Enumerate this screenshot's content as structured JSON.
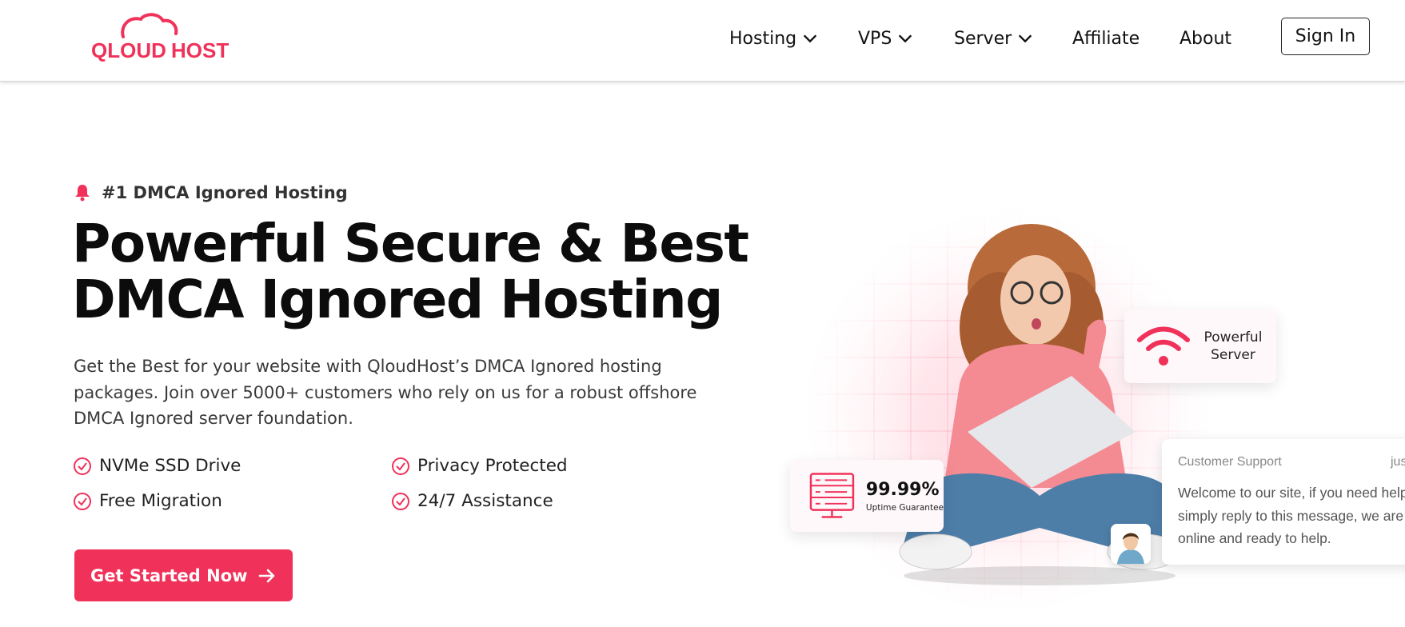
{
  "brand": {
    "name_part1": "QLOUD",
    "name_part2": "HOST",
    "color": "#f0325a"
  },
  "nav": {
    "items": [
      {
        "label": "Hosting",
        "has_dropdown": true
      },
      {
        "label": "VPS",
        "has_dropdown": true
      },
      {
        "label": "Server",
        "has_dropdown": true
      },
      {
        "label": "Affiliate",
        "has_dropdown": false
      },
      {
        "label": "About",
        "has_dropdown": false
      }
    ],
    "signin_label": "Sign In"
  },
  "hero": {
    "eyebrow": "#1 DMCA Ignored Hosting",
    "eyebrow_icon": "bell-icon",
    "headline_line1": "Powerful Secure & Best",
    "headline_line2": "DMCA Ignored Hosting",
    "description": "Get the Best for your website with QloudHost’s DMCA Ignored hosting packages. Join over 5000+ customers who rely on us for a robust offshore DMCA Ignored server foundation.",
    "features": [
      "NVMe SSD Drive",
      "Privacy Protected",
      "Free Migration",
      "24/7 Assistance"
    ],
    "feature_icon": "check-circle-icon",
    "cta_label": "Get Started Now",
    "cta_icon": "arrow-right-icon"
  },
  "cards": {
    "server_label": "Powerful Server",
    "server_icon": "wifi-icon",
    "uptime_value": "99.99%",
    "uptime_label": "Uptime Guarantee",
    "uptime_icon": "server-rack-icon"
  },
  "chat": {
    "from": "Customer Support",
    "time": "jus",
    "message_line1": "Welcome to our site, if you need help",
    "message_line2": "simply reply to this message, we are",
    "message_line3": "online and ready to help."
  },
  "colors": {
    "accent": "#f0325a",
    "text": "#111111"
  }
}
